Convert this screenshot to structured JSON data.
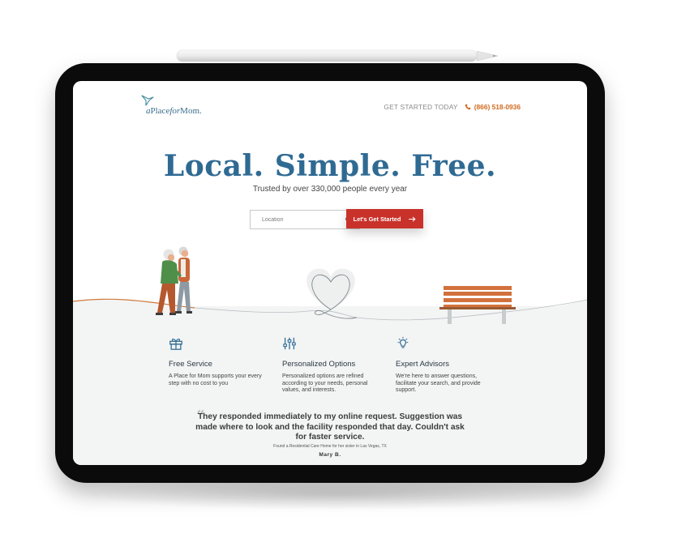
{
  "header": {
    "logo_text_a": "a",
    "logo_text_place": "Place",
    "logo_text_for": "for",
    "logo_text_mom": "Mom.",
    "cta_label": "GET STARTED TODAY",
    "phone_number": "(866) 518-0936",
    "phone_icon": "phone-icon"
  },
  "hero": {
    "title": "Local. Simple. Free.",
    "subtitle": "Trusted by over 330,000 people every year"
  },
  "search": {
    "placeholder": "Location",
    "icon": "location-pin-icon",
    "button_label": "Let's Get Started",
    "button_icon": "arrow-right-icon"
  },
  "features": [
    {
      "icon": "gift-icon",
      "title": "Free Service",
      "description": "A Place for Mom supports your every step with no cost to you"
    },
    {
      "icon": "sliders-icon",
      "title": "Personalized Options",
      "description": "Personalized options are refined according to your needs, personal values, and interests."
    },
    {
      "icon": "lightbulb-icon",
      "title": "Expert Advisors",
      "description": "We're here to answer questions, facilitate your search, and provide support."
    }
  ],
  "testimonial": {
    "quote": "They responded immediately to my online request. Suggestion was made where to look and the facility responded that day. Couldn't ask for faster service.",
    "source": "Found a Residential Care Home for her sister in Las Vegas, TX",
    "author": "Mary B."
  },
  "colors": {
    "brand_blue": "#2f6a93",
    "cta_red": "#c8322a",
    "phone_orange": "#d16a1f",
    "device_frame": "#0b0b0b"
  }
}
